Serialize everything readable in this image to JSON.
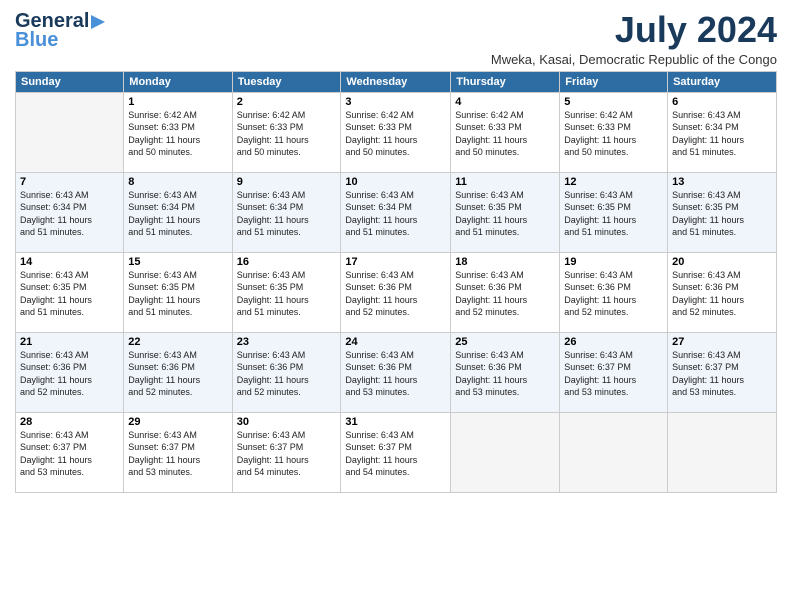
{
  "header": {
    "logo_general": "General",
    "logo_blue": "Blue",
    "month_year": "July 2024",
    "location": "Mweka, Kasai, Democratic Republic of the Congo"
  },
  "days_of_week": [
    "Sunday",
    "Monday",
    "Tuesday",
    "Wednesday",
    "Thursday",
    "Friday",
    "Saturday"
  ],
  "weeks": [
    [
      {
        "day": "",
        "info": ""
      },
      {
        "day": "1",
        "info": "Sunrise: 6:42 AM\nSunset: 6:33 PM\nDaylight: 11 hours\nand 50 minutes."
      },
      {
        "day": "2",
        "info": "Sunrise: 6:42 AM\nSunset: 6:33 PM\nDaylight: 11 hours\nand 50 minutes."
      },
      {
        "day": "3",
        "info": "Sunrise: 6:42 AM\nSunset: 6:33 PM\nDaylight: 11 hours\nand 50 minutes."
      },
      {
        "day": "4",
        "info": "Sunrise: 6:42 AM\nSunset: 6:33 PM\nDaylight: 11 hours\nand 50 minutes."
      },
      {
        "day": "5",
        "info": "Sunrise: 6:42 AM\nSunset: 6:33 PM\nDaylight: 11 hours\nand 50 minutes."
      },
      {
        "day": "6",
        "info": "Sunrise: 6:43 AM\nSunset: 6:34 PM\nDaylight: 11 hours\nand 51 minutes."
      }
    ],
    [
      {
        "day": "7",
        "info": "Sunrise: 6:43 AM\nSunset: 6:34 PM\nDaylight: 11 hours\nand 51 minutes."
      },
      {
        "day": "8",
        "info": "Sunrise: 6:43 AM\nSunset: 6:34 PM\nDaylight: 11 hours\nand 51 minutes."
      },
      {
        "day": "9",
        "info": "Sunrise: 6:43 AM\nSunset: 6:34 PM\nDaylight: 11 hours\nand 51 minutes."
      },
      {
        "day": "10",
        "info": "Sunrise: 6:43 AM\nSunset: 6:34 PM\nDaylight: 11 hours\nand 51 minutes."
      },
      {
        "day": "11",
        "info": "Sunrise: 6:43 AM\nSunset: 6:35 PM\nDaylight: 11 hours\nand 51 minutes."
      },
      {
        "day": "12",
        "info": "Sunrise: 6:43 AM\nSunset: 6:35 PM\nDaylight: 11 hours\nand 51 minutes."
      },
      {
        "day": "13",
        "info": "Sunrise: 6:43 AM\nSunset: 6:35 PM\nDaylight: 11 hours\nand 51 minutes."
      }
    ],
    [
      {
        "day": "14",
        "info": "Sunrise: 6:43 AM\nSunset: 6:35 PM\nDaylight: 11 hours\nand 51 minutes."
      },
      {
        "day": "15",
        "info": "Sunrise: 6:43 AM\nSunset: 6:35 PM\nDaylight: 11 hours\nand 51 minutes."
      },
      {
        "day": "16",
        "info": "Sunrise: 6:43 AM\nSunset: 6:35 PM\nDaylight: 11 hours\nand 51 minutes."
      },
      {
        "day": "17",
        "info": "Sunrise: 6:43 AM\nSunset: 6:36 PM\nDaylight: 11 hours\nand 52 minutes."
      },
      {
        "day": "18",
        "info": "Sunrise: 6:43 AM\nSunset: 6:36 PM\nDaylight: 11 hours\nand 52 minutes."
      },
      {
        "day": "19",
        "info": "Sunrise: 6:43 AM\nSunset: 6:36 PM\nDaylight: 11 hours\nand 52 minutes."
      },
      {
        "day": "20",
        "info": "Sunrise: 6:43 AM\nSunset: 6:36 PM\nDaylight: 11 hours\nand 52 minutes."
      }
    ],
    [
      {
        "day": "21",
        "info": "Sunrise: 6:43 AM\nSunset: 6:36 PM\nDaylight: 11 hours\nand 52 minutes."
      },
      {
        "day": "22",
        "info": "Sunrise: 6:43 AM\nSunset: 6:36 PM\nDaylight: 11 hours\nand 52 minutes."
      },
      {
        "day": "23",
        "info": "Sunrise: 6:43 AM\nSunset: 6:36 PM\nDaylight: 11 hours\nand 52 minutes."
      },
      {
        "day": "24",
        "info": "Sunrise: 6:43 AM\nSunset: 6:36 PM\nDaylight: 11 hours\nand 53 minutes."
      },
      {
        "day": "25",
        "info": "Sunrise: 6:43 AM\nSunset: 6:36 PM\nDaylight: 11 hours\nand 53 minutes."
      },
      {
        "day": "26",
        "info": "Sunrise: 6:43 AM\nSunset: 6:37 PM\nDaylight: 11 hours\nand 53 minutes."
      },
      {
        "day": "27",
        "info": "Sunrise: 6:43 AM\nSunset: 6:37 PM\nDaylight: 11 hours\nand 53 minutes."
      }
    ],
    [
      {
        "day": "28",
        "info": "Sunrise: 6:43 AM\nSunset: 6:37 PM\nDaylight: 11 hours\nand 53 minutes."
      },
      {
        "day": "29",
        "info": "Sunrise: 6:43 AM\nSunset: 6:37 PM\nDaylight: 11 hours\nand 53 minutes."
      },
      {
        "day": "30",
        "info": "Sunrise: 6:43 AM\nSunset: 6:37 PM\nDaylight: 11 hours\nand 54 minutes."
      },
      {
        "day": "31",
        "info": "Sunrise: 6:43 AM\nSunset: 6:37 PM\nDaylight: 11 hours\nand 54 minutes."
      },
      {
        "day": "",
        "info": ""
      },
      {
        "day": "",
        "info": ""
      },
      {
        "day": "",
        "info": ""
      }
    ]
  ]
}
